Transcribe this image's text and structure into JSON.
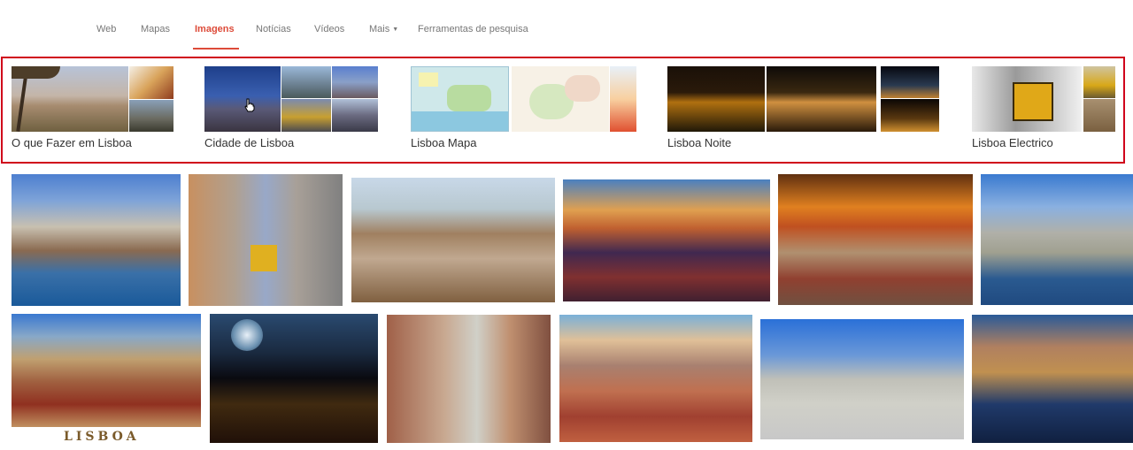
{
  "tabs": [
    {
      "label": "Web",
      "active": false
    },
    {
      "label": "Mapas",
      "active": false
    },
    {
      "label": "Imagens",
      "active": true
    },
    {
      "label": "Notícias",
      "active": false
    },
    {
      "label": "Vídeos",
      "active": false
    },
    {
      "label": "Mais",
      "active": false,
      "has_caret": true
    },
    {
      "label": "Ferramentas de pesquisa",
      "active": false
    }
  ],
  "related_searches": [
    {
      "label": "O que Fazer em Lisboa"
    },
    {
      "label": "Cidade de Lisboa"
    },
    {
      "label": "Lisboa Mapa"
    },
    {
      "label": "Lisboa Noite"
    },
    {
      "label": "Lisboa Electrico"
    }
  ],
  "results_row1": [
    {
      "subject": "Lisbon skyline over the Tagus river"
    },
    {
      "subject": "Yellow tram on narrow street"
    },
    {
      "subject": "Lisbon rooftops with 25 de Abril bridge"
    },
    {
      "subject": "Lisbon at dusk city lights"
    },
    {
      "subject": "Lisbon at sunset from viewpoint"
    },
    {
      "subject": "Lisbon waterfront and marina"
    }
  ],
  "results_row2": [
    {
      "subject": "Lisbon cathedral and old town",
      "logo_text": "LISBOA"
    },
    {
      "subject": "Lisbon at night with moon"
    },
    {
      "subject": "Rua Augusta arch street"
    },
    {
      "subject": "Lisbon rooftops panorama"
    },
    {
      "subject": "Praça do Comércio"
    },
    {
      "subject": "Lisbon riverside at evening"
    }
  ],
  "colors": {
    "accent": "#dd4b39",
    "highlight_border": "#d0021b",
    "tab_text": "#777777"
  }
}
